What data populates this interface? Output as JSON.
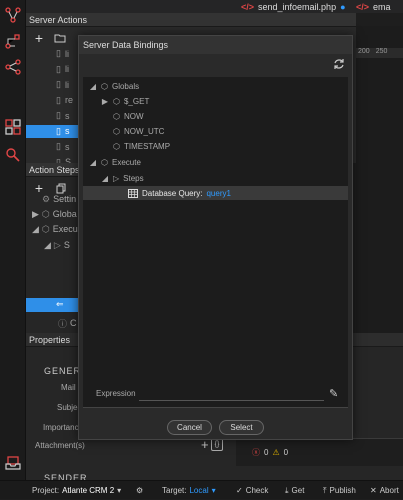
{
  "tabs": [
    {
      "label": "send_infoemail.php"
    },
    {
      "label": "ema"
    }
  ],
  "server_actions": {
    "title": "Server Actions",
    "files": [
      "li",
      "li",
      "li",
      "re",
      "s",
      "s",
      "s",
      "S"
    ],
    "ruler": [
      "200",
      "250"
    ]
  },
  "action_steps": {
    "title": "Action Steps",
    "rows": [
      "Settin",
      "Globa",
      "Execu",
      "S",
      "C"
    ]
  },
  "properties": {
    "title": "Properties",
    "section_general": "GENERA",
    "mail_label": "Mail",
    "subject_label": "Subjec",
    "importance_label": "Importanc",
    "attachments_label": "Attachment(s)",
    "section_sender": "SENDER"
  },
  "modal": {
    "title": "Server Data Bindings",
    "tree": [
      {
        "label": "Globals"
      },
      {
        "label": "$_GET"
      },
      {
        "label": "NOW"
      },
      {
        "label": "NOW_UTC"
      },
      {
        "label": "TIMESTAMP"
      },
      {
        "label": "Execute"
      },
      {
        "label": "Steps"
      },
      {
        "label": "Database Query:",
        "value": "query1"
      }
    ],
    "expression_label": "Expression",
    "cancel_label": "Cancel",
    "select_label": "Select"
  },
  "status_bar": {
    "project_label": "Project:",
    "project_value": "Atlante CRM 2",
    "target_label": "Target:",
    "target_value": "Local",
    "errors_count": "0",
    "warnings_count": "0",
    "check_label": "Check",
    "get_label": "Get",
    "publish_label": "Publish",
    "abort_label": "Abort"
  },
  "colors": {
    "accent": "#2f8fe8",
    "link": "#2f9bff",
    "error": "#e04646",
    "warning": "#e0b400"
  }
}
